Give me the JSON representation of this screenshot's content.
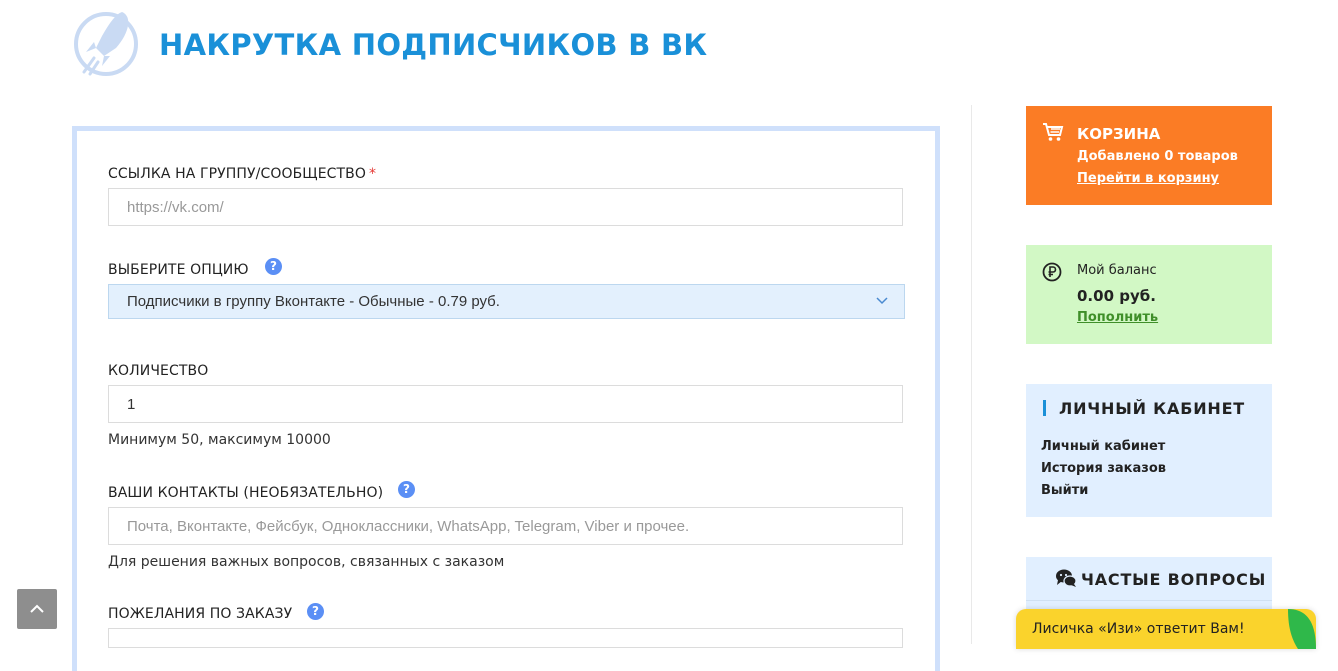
{
  "header": {
    "title": "НАКРУТКА ПОДПИСЧИКОВ В ВК",
    "logo_icon": "rocket-icon"
  },
  "form": {
    "link": {
      "label": "ССЫЛКА НА ГРУППУ/СООБЩЕСТВО",
      "required_mark": "*",
      "placeholder": "https://vk.com/",
      "value": ""
    },
    "option": {
      "label": "ВЫБЕРИТЕ ОПЦИЮ",
      "help": "?",
      "selected": "Подписчики в группу Вконтакте - Обычные - 0.79 руб."
    },
    "quantity": {
      "label": "КОЛИЧЕСТВО",
      "value": "1",
      "hint": "Минимум 50, максимум 10000"
    },
    "contacts": {
      "label": "ВАШИ КОНТАКТЫ (НЕОБЯЗАТЕЛЬНО)",
      "help": "?",
      "placeholder": "Почта, Вконтакте, Фейсбук, Одноклассники, WhatsApp, Telegram, Viber и прочее.",
      "hint": "Для решения важных вопросов, связанных с заказом"
    },
    "wishes": {
      "label": "ПОЖЕЛАНИЯ ПО ЗАКАЗУ",
      "help": "?"
    }
  },
  "sidebar": {
    "cart": {
      "title": "КОРЗИНА",
      "info": "Добавлено 0 товаров",
      "link": "Перейти в корзину",
      "color": "#fb7c25"
    },
    "balance": {
      "label": "Мой баланс",
      "value": "0.00 руб.",
      "link": "Пополнить",
      "color": "#d2f8c5"
    },
    "cabinet": {
      "title": "ЛИЧНЫЙ КАБИНЕТ",
      "links": [
        "Личный кабинет",
        "История заказов",
        "Выйти"
      ]
    },
    "faq": {
      "title": "ЧАСТЫЕ ВОПРОСЫ"
    }
  },
  "chat": {
    "text": "Лисичка «Изи» ответит Вам!"
  },
  "colors": {
    "accent": "#1a90d8",
    "help_badge": "#5b8ff5",
    "form_border": "#cfe0fb",
    "chat": "#fad32c"
  }
}
